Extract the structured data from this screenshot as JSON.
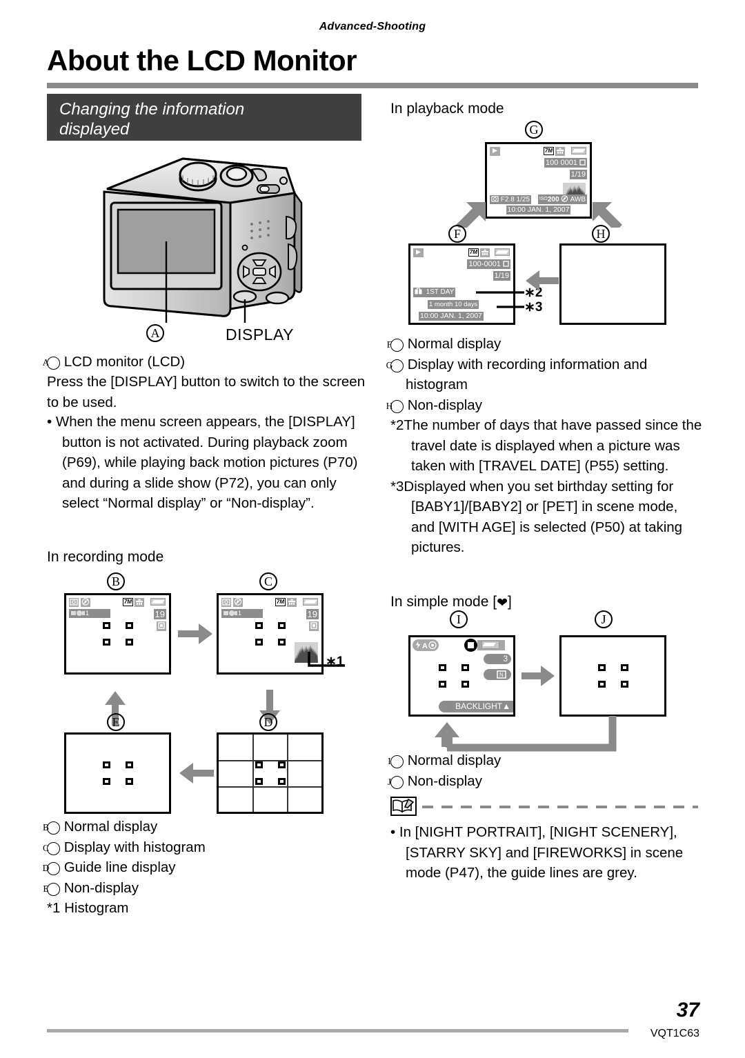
{
  "header": {
    "running_head": "Advanced-Shooting",
    "title": "About the LCD Monitor",
    "section_banner_line1": "Changing the information",
    "section_banner_line2": "displayed"
  },
  "camera": {
    "marker_a": "A",
    "display_button_label": "DISPLAY"
  },
  "left_column": {
    "item_a_label": "A",
    "item_a_text": "LCD monitor (LCD)",
    "intro": "Press the [DISPLAY] button to switch to the screen to be used.",
    "bullet_1": "When the menu screen appears, the [DISPLAY] button is not activated. During playback zoom (P69), while playing back motion pictures (P70) and during a slide show (P72), you can only select “Normal display” or “Non-display”.",
    "recording_mode_heading": "In recording mode",
    "markers": {
      "b": "B",
      "c": "C",
      "d": "D",
      "e": "E"
    },
    "star1_label": "∗1",
    "legend": [
      {
        "marker": "B",
        "text": "Normal display"
      },
      {
        "marker": "C",
        "text": "Display with histogram"
      },
      {
        "marker": "D",
        "text": "Guide line display"
      },
      {
        "marker": "E",
        "text": "Non-display"
      }
    ],
    "footnote_1_marker": "*1",
    "footnote_1_text": "Histogram"
  },
  "right_column": {
    "playback_heading": "In playback mode",
    "markers": {
      "f": "F",
      "g": "G",
      "h": "H",
      "i": "I",
      "j": "J"
    },
    "star2_label": "∗2",
    "star3_label": "∗3",
    "legend": [
      {
        "marker": "F",
        "text": "Normal display"
      },
      {
        "marker": "G",
        "text": "Display with recording information and histogram"
      },
      {
        "marker": "H",
        "text": "Non-display"
      }
    ],
    "footnote_2_marker": "*2",
    "footnote_2_text": "The number of days that have passed since the travel date is displayed when a picture was taken with [TRAVEL DATE] (P55) setting.",
    "footnote_3_marker": "*3",
    "footnote_3_text": "Displayed when you set birthday setting for [BABY1]/[BABY2] or [PET] in scene mode, and [WITH AGE] is selected (P50) at taking pictures.",
    "simple_mode_heading_pre": "In simple mode [",
    "simple_mode_heading_post": "]",
    "simple_legend": [
      {
        "marker": "I",
        "text": "Normal display"
      },
      {
        "marker": "J",
        "text": "Non-display"
      }
    ],
    "memo_bullet": "In [NIGHT PORTRAIT], [NIGHT SCENERY], [STARRY SKY] and [FIREWORKS] in scene mode (P47), the guide lines are grey."
  },
  "lcd_screens": {
    "rec_normal": {
      "pixels": "7M",
      "shots_remaining": "19",
      "stabilizer": "1"
    },
    "rec_histogram": {
      "pixels": "7M",
      "shots_remaining": "19",
      "stabilizer": "1"
    },
    "playback_info": {
      "pixels": "7M",
      "folder_file": "100 0001",
      "frame": "1/19",
      "aperture_shutter": "F2.8 1/25",
      "iso_prefix": "ISO",
      "iso": "200",
      "white_balance": "AWB",
      "datetime": "10:00 JAN. 1, 2007"
    },
    "playback_normal": {
      "pixels": "7M",
      "folder_file": "100-0001",
      "frame": "1/19",
      "travel_date": "1ST DAY",
      "age": "1 month 10 days",
      "datetime": "10:00 JAN. 1, 2007"
    },
    "simple_normal": {
      "flash_mode": "A",
      "burst": "3",
      "backlight": "BACKLIGHT"
    }
  },
  "footer": {
    "page_number": "37",
    "doc_code": "VQT1C63"
  },
  "colors": {
    "banner_bg": "#404040",
    "rule_grey": "#8a8a8a",
    "arrow_grey": "#8a8a8a",
    "chip_grey": "#8d8d8d"
  }
}
